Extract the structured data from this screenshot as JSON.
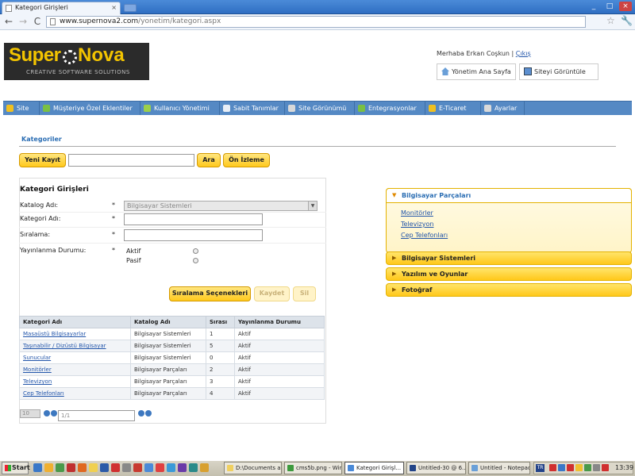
{
  "browser": {
    "tab_title": "Kategori Girişleri",
    "tab_close": "×",
    "url_host": "www.supernova2.com",
    "url_path": "/yonetim/kategori.aspx",
    "win_min": "_",
    "win_max": "□",
    "win_close": "×",
    "back": "←",
    "forward": "→",
    "reload": "C",
    "star": "☆",
    "wrench": "🔧"
  },
  "header": {
    "logo_part1": "Super",
    "logo_part2": "Nova",
    "logo_tagline": "CREATIVE SOFTWARE SOLUTIONS",
    "greeting": "Merhaba Erkan Coşkun | ",
    "logout": "Çıkış",
    "home_button": "Yönetim Ana Sayfa",
    "view_site_button": "Siteyi Görüntüle"
  },
  "menu": [
    {
      "label": "Site",
      "icon": "star-icon",
      "color": "#f0c020"
    },
    {
      "label": "Müşteriye Özel Eklentiler",
      "icon": "plug-icon",
      "color": "#7ac043"
    },
    {
      "label": "Kullanıcı Yönetimi",
      "icon": "user-icon",
      "color": "#9ccf4a"
    },
    {
      "label": "Sabit Tanımlar",
      "icon": "list-icon",
      "color": "#e8eef6"
    },
    {
      "label": "Site Görünümü",
      "icon": "gear-icon",
      "color": "#d9d9d9"
    },
    {
      "label": "Entegrasyonlar",
      "icon": "plug-icon",
      "color": "#7ac043"
    },
    {
      "label": "E-Ticaret",
      "icon": "cart-icon",
      "color": "#f0c020"
    },
    {
      "label": "Ayarlar",
      "icon": "gear-icon",
      "color": "#d9d9d9"
    }
  ],
  "section_title": "Kategoriler",
  "actions": {
    "new": "Yeni Kayıt",
    "search": "Ara",
    "preview": "Ön İzleme",
    "search_value": ""
  },
  "form": {
    "title": "Kategori Girişleri",
    "catalog_label": "Katalog Adı:",
    "catalog_value": "Bilgisayar Sistemleri",
    "category_label": "Kategori Adı:",
    "order_label": "Sıralama:",
    "publish_label": "Yayınlanma Durumu:",
    "required_mark": "*",
    "active": "Aktif",
    "passive": "Pasif",
    "sort_options": "Sıralama Seçenekleri",
    "save": "Kaydet",
    "delete": "Sil"
  },
  "grid": {
    "columns": [
      "Kategori Adı",
      "Katalog Adı",
      "Sırası",
      "Yayınlanma Durumu"
    ],
    "rows": [
      [
        "Masaüstü Bilgisayarlar",
        "Bilgisayar Sistemleri",
        "1",
        "Aktif"
      ],
      [
        "Taşınabilir / Dizüstü Bilgisayar",
        "Bilgisayar Sistemleri",
        "5",
        "Aktif"
      ],
      [
        "Sunucular",
        "Bilgisayar Sistemleri",
        "0",
        "Aktif"
      ],
      [
        "Monitörler",
        "Bilgisayar Parçaları",
        "2",
        "Aktif"
      ],
      [
        "Televizyon",
        "Bilgisayar Parçaları",
        "3",
        "Aktif"
      ],
      [
        "Cep Telefonları",
        "Bilgisayar Parçaları",
        "4",
        "Aktif"
      ]
    ],
    "page_size": "10",
    "page_info": "1/1"
  },
  "accordion": {
    "open_title": "Bilgisayar Parçaları",
    "open_items": [
      "Monitörler",
      "Televizyon",
      "Cep Telefonları"
    ],
    "closed": [
      "Bilgisayar Sistemleri",
      "Yazılım ve Oyunlar",
      "Fotoğraf"
    ]
  },
  "taskbar": {
    "start": "Start",
    "tasks": [
      {
        "label": "D:\\Documents a...",
        "color": "#f0d060"
      },
      {
        "label": "cms5b.png - Win...",
        "color": "#3d9a3d"
      },
      {
        "label": "Kategori Girişl...",
        "color": "#4a8ad8",
        "active": true
      },
      {
        "label": "Untitled-30 @ 6...",
        "color": "#224488"
      },
      {
        "label": "Untitled - Notepad",
        "color": "#6aa0d8"
      }
    ],
    "lang": "TR",
    "time": "13:39"
  }
}
